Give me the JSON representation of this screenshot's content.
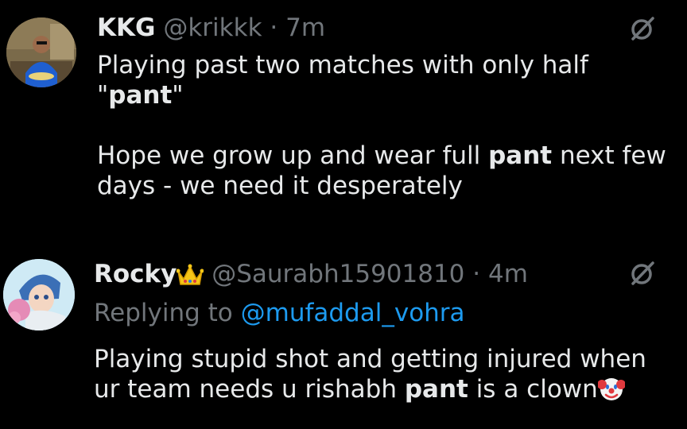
{
  "tweets": [
    {
      "name": "KKG",
      "handle": "@krikkk",
      "separator": "·",
      "time": "7m",
      "body": {
        "line1": "Playing past two matches with only half",
        "line2_pre": "\"",
        "line2_bold": "pant",
        "line2_post": "\"",
        "line4_pre": "Hope we grow up and wear full ",
        "line4_bold": "pant",
        "line4_post": " next few",
        "line5": "days - we need it desperately"
      },
      "icon": "grok-slash-icon"
    },
    {
      "name": "Rocky",
      "badge_icon": "crown-emoji",
      "handle": "@Saurabh15901810",
      "separator": "·",
      "time": "4m",
      "reply_prefix": "Replying to ",
      "reply_mention": "@mufaddal_vohra",
      "body": {
        "line1": "Playing stupid shot and getting injured when",
        "line2_pre": "ur team needs u rishabh ",
        "line2_bold": "pant",
        "line2_post": " is a clown"
      },
      "trailing_icon": "clown-emoji",
      "icon": "grok-slash-icon"
    }
  ],
  "colors": {
    "background": "#000000",
    "text": "#e7e9ea",
    "muted": "#71767b",
    "link": "#1d9bf0"
  }
}
